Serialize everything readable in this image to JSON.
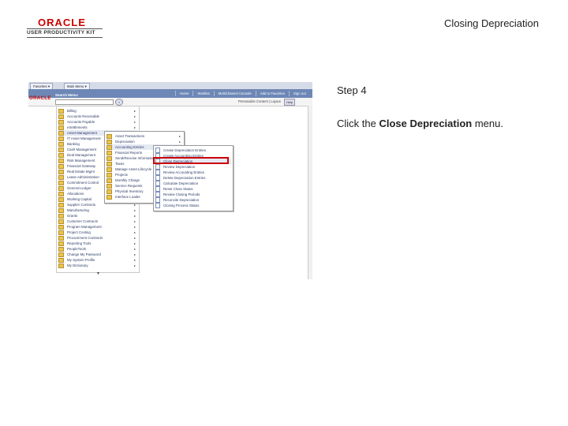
{
  "header": {
    "logo_text": "ORACLE",
    "logo_subtext": "USER PRODUCTIVITY KIT",
    "title": "Closing Depreciation"
  },
  "step": {
    "label": "Step 4",
    "instruction_prefix": "Click the ",
    "instruction_target": "Close Depreciation",
    "instruction_suffix": " menu."
  },
  "screenshot": {
    "tabs": [
      "Favorites",
      "Main Menu"
    ],
    "nav_links": [
      "Home",
      "Worklist",
      "MultiChannel Console",
      "Add to Favorites",
      "Sign out"
    ],
    "search_label": "Search Menu:",
    "personalize": "Personalize Content | Layout",
    "help_label": "Help",
    "menu_level1": [
      "Billing",
      "Accounts Receivable",
      "Accounts Payable",
      "eSettlements",
      "Asset Management",
      "IT Asset Management",
      "Banking",
      "Cash Management",
      "Deal Management",
      "Risk Management",
      "Financial Gateway",
      "Real Estate Mgmt",
      "Lease Administration",
      "Commitment Control",
      "General Ledger",
      "Allocations",
      "Working Capital",
      "Supplier Contracts",
      "Manufacturing",
      "Grants",
      "Customer Contracts",
      "Program Management",
      "Project Costing",
      "Procurement Contracts",
      "Reporting Tools",
      "PeopleTools",
      "Change My Password",
      "My System Profile",
      "My Dictionary"
    ],
    "menu_level2": [
      "Asset Transactions",
      "Depreciation",
      "Accounting Entries",
      "Financial Reports",
      "Send/Receive Information",
      "Taxes",
      "Manage Asset Lifecycle",
      "Projects",
      "Monthly Charge",
      "Service Requests",
      "Physical Inventory",
      "Interface Loader"
    ],
    "menu_level3": [
      "Create Depreciation Entries",
      "Create Accounting Entries",
      "Close Depreciation",
      "Review Depreciation",
      "Review Accounting Entries",
      "Delete Depreciation Entries",
      "Calculate Depreciation",
      "Reset Close Status",
      "Review Closing Periods",
      "Reconcile Depreciation",
      "Closing Process Status"
    ]
  }
}
